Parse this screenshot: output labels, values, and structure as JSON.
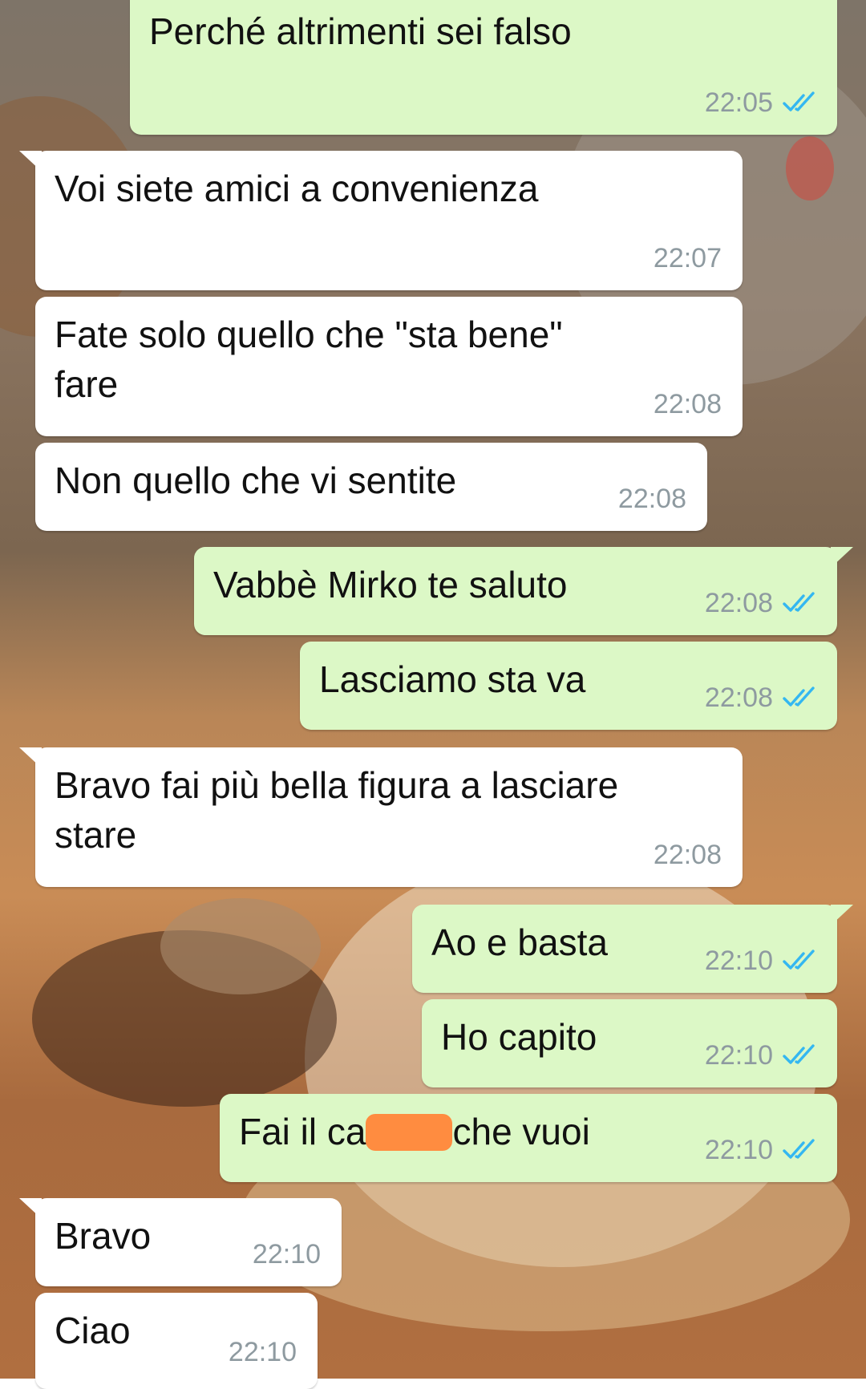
{
  "messages": [
    {
      "text": "Perché altrimenti sei falso",
      "time": "22:05",
      "ticks": "double-check-blue-icon"
    },
    {
      "text": "Voi siete amici a convenienza",
      "time": "22:07"
    },
    {
      "text": "Fate solo quello che \"sta bene\"\nfare",
      "time": "22:08"
    },
    {
      "text": "Non quello che vi sentite",
      "time": "22:08"
    },
    {
      "text": "Vabbè Mirko te saluto",
      "time": "22:08",
      "ticks": "double-check-blue-icon"
    },
    {
      "text": "Lasciamo sta va",
      "time": "22:08",
      "ticks": "double-check-blue-icon"
    },
    {
      "text": "Bravo fai più bella figura a lasciare\nstare",
      "time": "22:08"
    },
    {
      "text": "Ao e basta",
      "time": "22:10",
      "ticks": "double-check-blue-icon"
    },
    {
      "text": "Ho capito",
      "time": "22:10",
      "ticks": "double-check-blue-icon"
    },
    {
      "text_before": "Fai il ca",
      "text_after": "che vuoi",
      "time": "22:10",
      "ticks": "double-check-blue-icon"
    },
    {
      "text": "Bravo",
      "time": "22:10"
    },
    {
      "text": "Ciao",
      "time": "22:10"
    }
  ],
  "colors": {
    "incoming_bubble": "#ffffff",
    "outgoing_bubble": "#dcf8c6",
    "read_ticks": "#34b7f1",
    "censor_mark": "#ff8c40"
  }
}
